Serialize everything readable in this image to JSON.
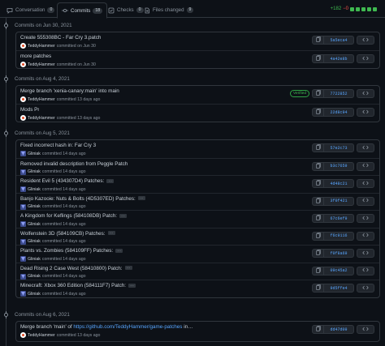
{
  "tabs": [
    {
      "label": "Conversation",
      "count": "0"
    },
    {
      "label": "Commits",
      "count": "18"
    },
    {
      "label": "Checks",
      "count": "0"
    },
    {
      "label": "Files changed",
      "count": "9"
    }
  ],
  "diffstat": {
    "additions": "+182",
    "deletions": "−0"
  },
  "colors": {
    "bg": "#0d1117",
    "border": "#30363d",
    "link": "#58a6ff",
    "add": "#3fb950",
    "del": "#f85149"
  },
  "days": [
    {
      "heading": "Commits on Jun 30, 2021",
      "commits": [
        {
          "title": "Create 555308BC - Far Cry 3.patch",
          "author": "TeddyHammer",
          "when": "committed on Jun 30",
          "sha": "5a5eca4",
          "avatar": "th"
        },
        {
          "title": "more patches",
          "author": "TeddyHammer",
          "when": "committed on Jun 30",
          "sha": "4a42e8b",
          "avatar": "th"
        }
      ]
    },
    {
      "heading": "Commits on Aug 4, 2021",
      "commits": [
        {
          "title": "Merge branch 'xenia-canary:main' into main",
          "author": "TeddyHammer",
          "when": "committed 13 days ago",
          "sha": "7722852",
          "avatar": "th",
          "verified": "Verified"
        },
        {
          "title": "Mods Pr",
          "author": "TeddyHammer",
          "when": "committed 13 days ago",
          "sha": "22d8c94",
          "avatar": "th"
        }
      ]
    },
    {
      "heading": "Commits on Aug 5, 2021",
      "commits": [
        {
          "title": "Fixed incorrect hash in: Far Cry 3",
          "author": "Gliniak",
          "when": "committed 14 days ago",
          "sha": "57e2c73",
          "avatar": "gl"
        },
        {
          "title": "Removed invalid description from Peggle Patch",
          "author": "Gliniak",
          "when": "committed 14 days ago",
          "sha": "b3c7659",
          "avatar": "gl"
        },
        {
          "title": "Resident Evil 5 (434307D4) Patches:",
          "author": "Gliniak",
          "when": "committed 14 days ago",
          "sha": "4d48c21",
          "avatar": "gl",
          "more": "…"
        },
        {
          "title": "Banjo Kazooie: Nuts & Bolts (4D5307ED) Patches:",
          "author": "Gliniak",
          "when": "committed 14 days ago",
          "sha": "3f0f421",
          "avatar": "gl",
          "more": "…"
        },
        {
          "title": "A Kingdom for Keflings (584108DB) Patch:",
          "author": "Gliniak",
          "when": "committed 14 days ago",
          "sha": "67c6ef9",
          "avatar": "gl",
          "more": "…"
        },
        {
          "title": "Wolfenstein 3D (584109CB) Patches:",
          "author": "Gliniak",
          "when": "committed 14 days ago",
          "sha": "f6c9116",
          "avatar": "gl",
          "more": "…"
        },
        {
          "title": "Plants vs. Zombies (584109FF) Patches:",
          "author": "Gliniak",
          "when": "committed 14 days ago",
          "sha": "f0f8a69",
          "avatar": "gl",
          "more": "…"
        },
        {
          "title": "Dead Rising 2 Case West (58410800) Patch:",
          "author": "Gliniak",
          "when": "committed 14 days ago",
          "sha": "09c45a2",
          "avatar": "gl",
          "more": "…"
        },
        {
          "title": "Minecraft: Xbox 360 Edition (584111F7) Patch:",
          "author": "Gliniak",
          "when": "committed 14 days ago",
          "sha": "9d5ffe4",
          "avatar": "gl",
          "more": "…"
        }
      ]
    },
    {
      "heading": "Commits on Aug 6, 2021",
      "commits": [
        {
          "title": "Merge branch 'main' of ",
          "link": "https://github.com/TeddyHammer/game-patches",
          "title_tail": " in…",
          "author": "TeddyHammer",
          "when": "committed 13 days ago",
          "sha": "dd47d09",
          "avatar": "th"
        }
      ]
    }
  ]
}
